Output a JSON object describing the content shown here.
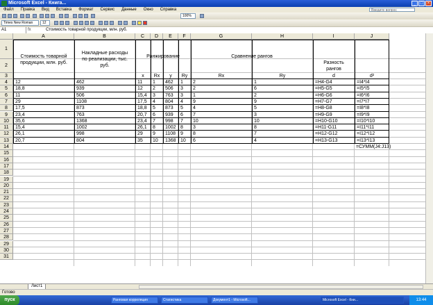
{
  "window": {
    "title": "Microsoft Excel - Книга..."
  },
  "menu": [
    "Файл",
    "Правка",
    "Вид",
    "Вставка",
    "Формат",
    "Сервис",
    "Данные",
    "Окно",
    "Справка"
  ],
  "help_placeholder": "Введите вопрос",
  "toolbar": {
    "font_name": "Times New Roman",
    "font_size": "12",
    "zoom": "100%"
  },
  "formula": {
    "cell_ref": "A1",
    "fx": "fx",
    "text": "Стоимость товарной продукции, млн. руб."
  },
  "columns": [
    "A",
    "B",
    "C",
    "D",
    "E",
    "F",
    "G",
    "H",
    "I",
    "J"
  ],
  "rows": [
    "1",
    "2",
    "3",
    "4",
    "5",
    "6",
    "7",
    "8",
    "9",
    "10",
    "11",
    "12",
    "13",
    "14",
    "15",
    "16",
    "17",
    "18",
    "19",
    "20",
    "21",
    "22",
    "23",
    "24",
    "25",
    "26",
    "27",
    "28",
    "29",
    "30",
    "31"
  ],
  "headers": {
    "a": "Стоимость товарной продукции, млн. руб.",
    "b": "Накладные расходы по реализации, тыс. руб.",
    "ranking": "Ранжирование",
    "x": "x",
    "rx": "Rx",
    "y": "y",
    "ry": "Ry",
    "compare": "Сравнение рангов",
    "rx_col": "Rx",
    "ry_col": "Ry",
    "diff": "Разность рангов",
    "d": "d",
    "d2": "d²"
  },
  "table": [
    [
      "12",
      "462",
      "11",
      "1",
      "462",
      "1",
      "2",
      "1",
      "=H4-G4",
      "=I4*I4"
    ],
    [
      "18,8",
      "939",
      "12",
      "2",
      "506",
      "3",
      "2",
      "6",
      "=H5-G5",
      "=I5*I5"
    ],
    [
      "11",
      "506",
      "15,4",
      "3",
      "763",
      "3",
      "1",
      "2",
      "=H6-G6",
      "=I6*I6"
    ],
    [
      "29",
      "1108",
      "17,5",
      "4",
      "804",
      "4",
      "9",
      "9",
      "=H7-G7",
      "=I7*I7"
    ],
    [
      "17,5",
      "873",
      "18,8",
      "5",
      "873",
      "5",
      "4",
      "5",
      "=H8-G8",
      "=I8*I8"
    ],
    [
      "23,4",
      "763",
      "20,7",
      "6",
      "939",
      "6",
      "7",
      "3",
      "=H9-G9",
      "=I9*I9"
    ],
    [
      "35,6",
      "1368",
      "23,4",
      "7",
      "998",
      "7",
      "10",
      "10",
      "=H10-G10",
      "=I10*I10"
    ],
    [
      "15,4",
      "1002",
      "26,1",
      "8",
      "1002",
      "8",
      "3",
      "8",
      "=H11-G11",
      "=I11*I11"
    ],
    [
      "26,1",
      "998",
      "29",
      "9",
      "1108",
      "9",
      "8",
      "7",
      "=H12-G12",
      "=I12*I12"
    ],
    [
      "20,7",
      "804",
      "35",
      "10",
      "1368",
      "10",
      "6",
      "4",
      "=H13-G13",
      "=I13*I13"
    ]
  ],
  "j14": "=СУММ(J4:J13)",
  "sheet_tab": "Лист1",
  "status": "Готово",
  "taskbar": {
    "start": "пуск",
    "items": [
      "Ранговая корреляция",
      "Статистика",
      "Документ1 - Microsoft...",
      "Microsoft Excel - Кни..."
    ],
    "clock": "13:44"
  }
}
